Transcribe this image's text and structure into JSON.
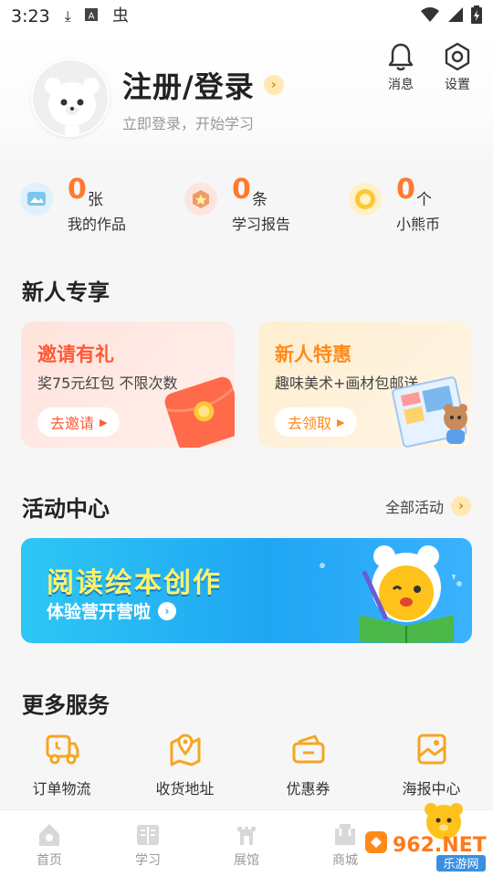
{
  "status_bar": {
    "time": "3:23"
  },
  "header": {
    "title": "注册/登录",
    "subtitle": "立即登录，开始学习",
    "messages_label": "消息",
    "settings_label": "设置"
  },
  "stats": [
    {
      "value": "0",
      "unit": "张",
      "label": "我的作品"
    },
    {
      "value": "0",
      "unit": "条",
      "label": "学习报告"
    },
    {
      "value": "0",
      "unit": "个",
      "label": "小熊币"
    }
  ],
  "newbie": {
    "section_title": "新人专享",
    "invite": {
      "title": "邀请有礼",
      "desc": "奖75元红包 不限次数",
      "button": "去邀请"
    },
    "offer": {
      "title": "新人特惠",
      "desc": "趣味美术+画材包邮送",
      "button": "去领取"
    }
  },
  "activity": {
    "section_title": "活动中心",
    "all_label": "全部活动",
    "banner_title": "阅读绘本创作",
    "banner_subtitle": "体验营开营啦"
  },
  "more_services": {
    "section_title": "更多服务",
    "items": [
      {
        "label": "订单物流",
        "icon": "truck-icon"
      },
      {
        "label": "收货地址",
        "icon": "map-pin-icon"
      },
      {
        "label": "优惠券",
        "icon": "coupon-icon"
      },
      {
        "label": "海报中心",
        "icon": "poster-icon"
      }
    ]
  },
  "tabbar": [
    {
      "label": "首页",
      "icon": "home-icon"
    },
    {
      "label": "学习",
      "icon": "book-icon"
    },
    {
      "label": "展馆",
      "icon": "gallery-icon"
    },
    {
      "label": "商城",
      "icon": "shop-icon"
    },
    {
      "label": "",
      "icon": "bear-icon"
    }
  ],
  "watermark": {
    "text": "962.NET",
    "subtext": "乐游网"
  },
  "colors": {
    "accent": "#ff7a2f",
    "invite_bg": "#ffe9e3",
    "offer_bg": "#fff1dc",
    "banner": "#1fa6f3"
  }
}
